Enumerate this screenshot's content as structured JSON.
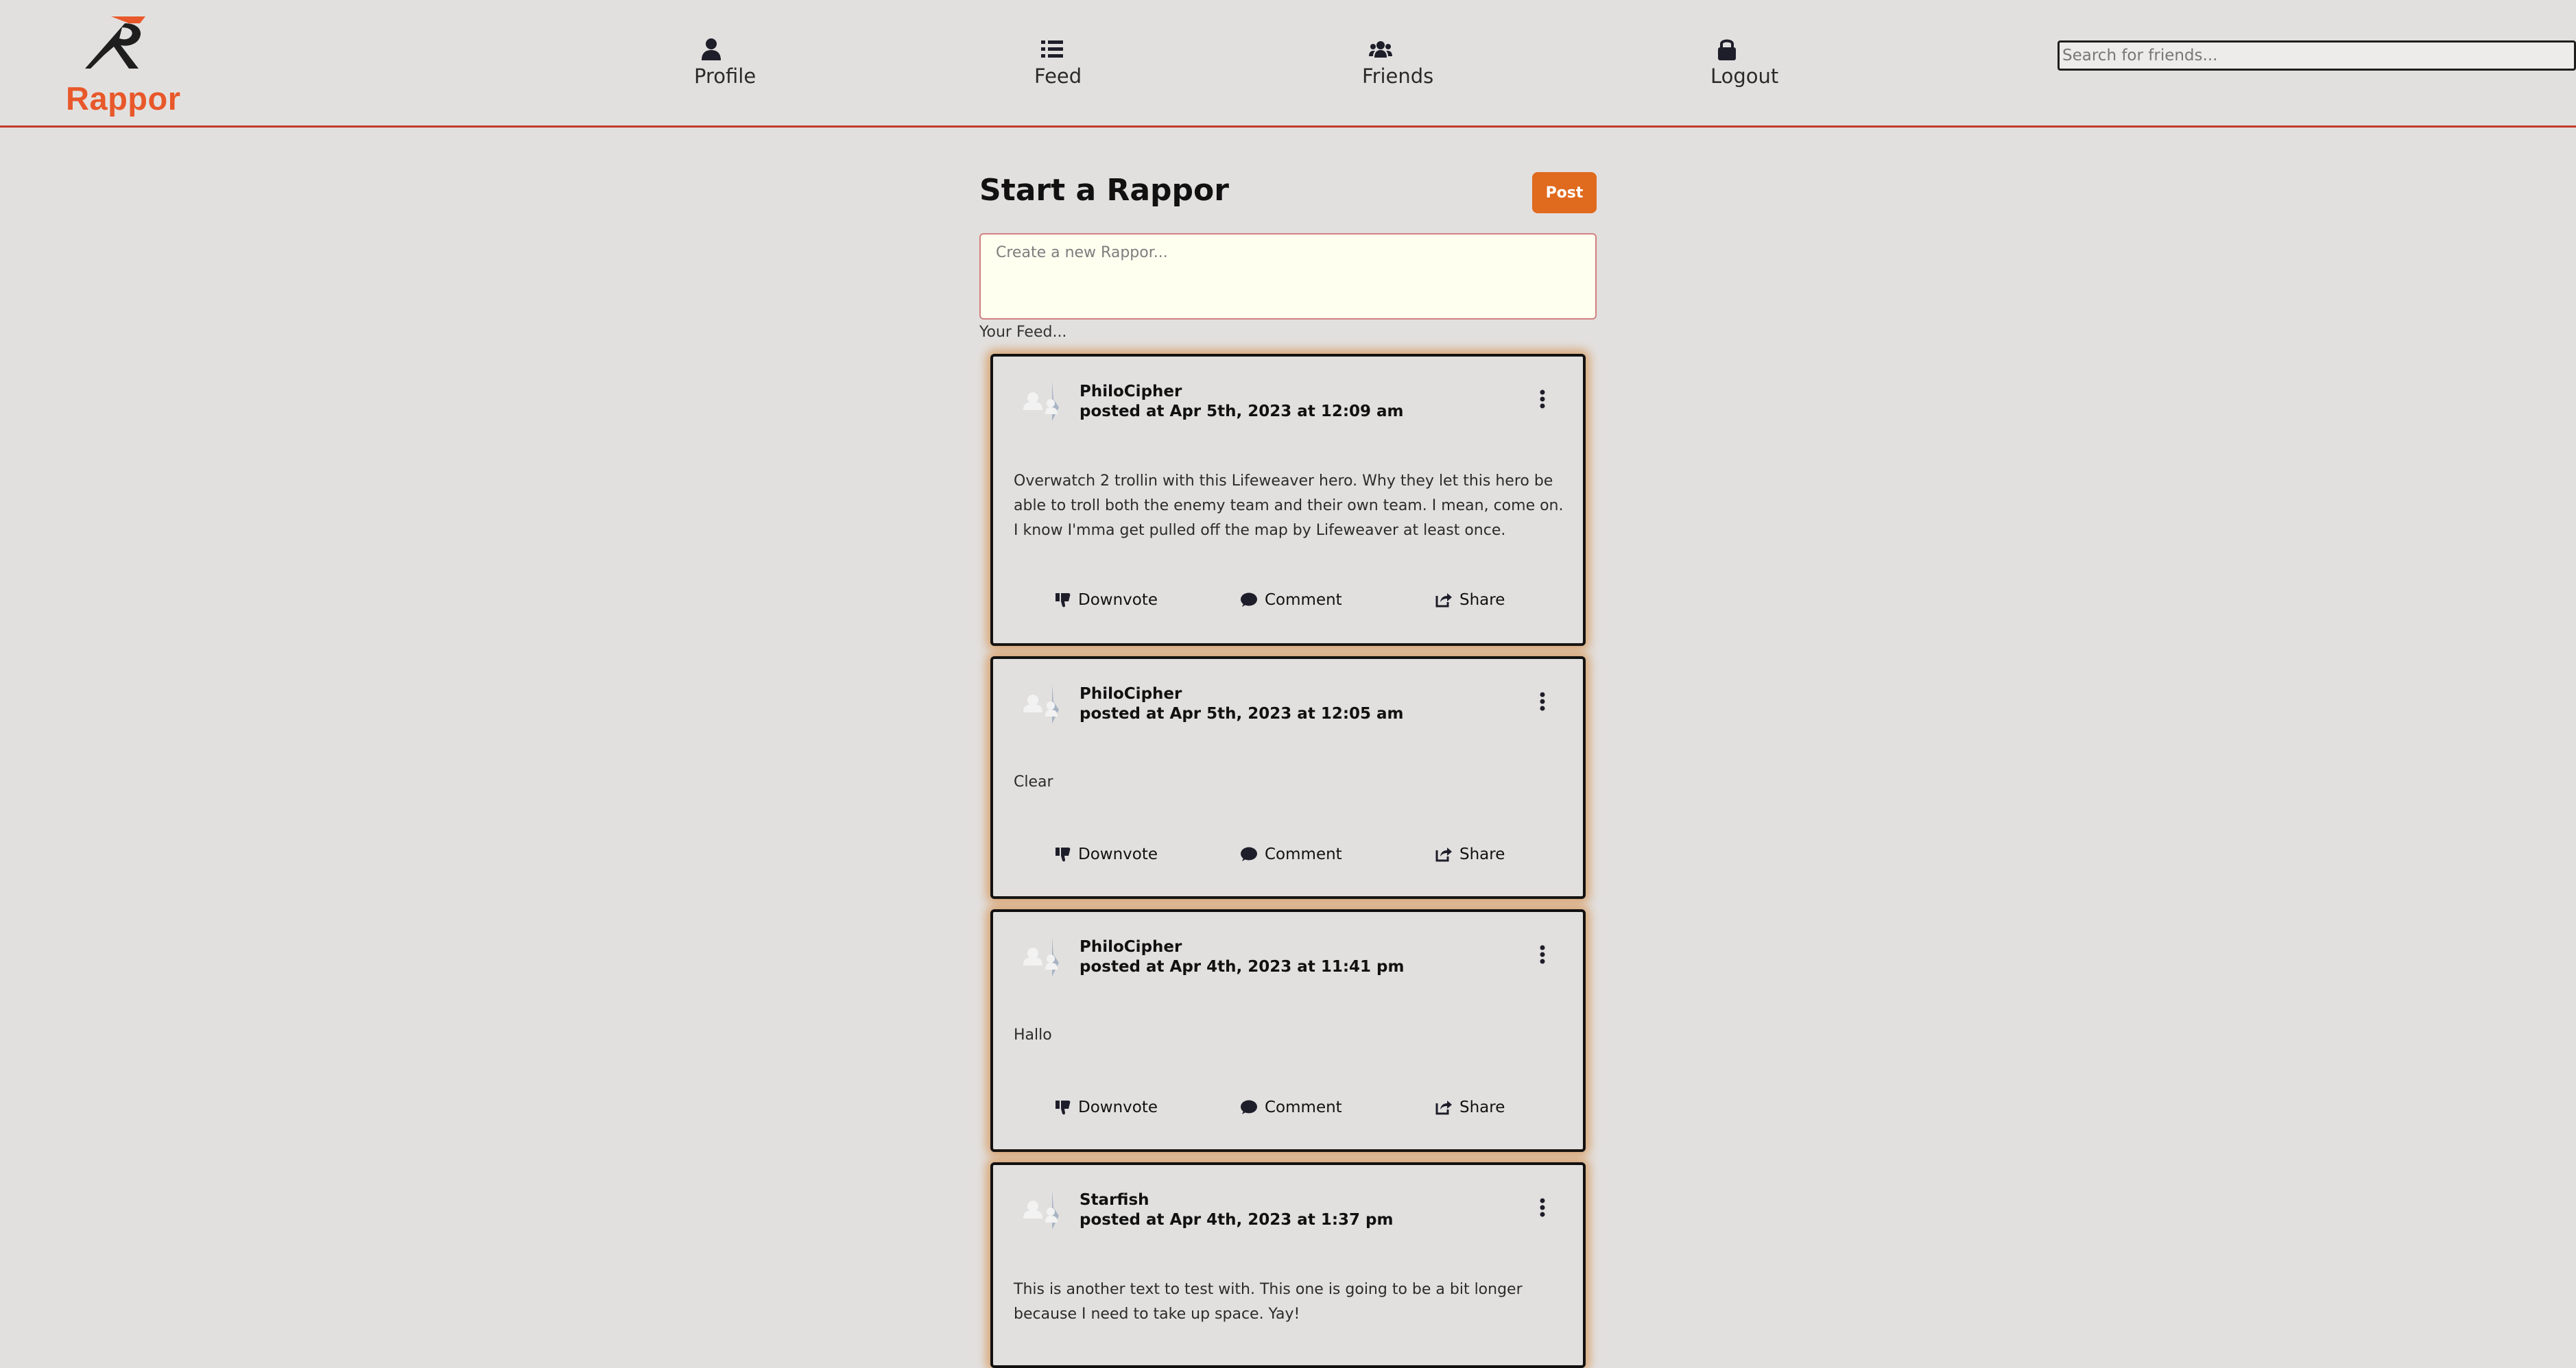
{
  "app": {
    "brand": "Rappor",
    "brand_color": "#e8582a",
    "accent_color": "#e06a1e",
    "divider_color": "#c23b2a"
  },
  "nav": {
    "items": [
      {
        "label": "Profile",
        "icon": "user-icon"
      },
      {
        "label": "Feed",
        "icon": "list-icon"
      },
      {
        "label": "Friends",
        "icon": "users-icon"
      },
      {
        "label": "Logout",
        "icon": "lock-icon"
      }
    ],
    "search_placeholder": "Search for friends..."
  },
  "composer": {
    "title": "Start a Rappor",
    "post_label": "Post",
    "placeholder": "Create a new Rappor...",
    "feed_label": "Your Feed..."
  },
  "posts": [
    {
      "author": "PhiloCipher",
      "time": "posted at Apr 5th, 2023 at 12:09 am",
      "body": "Overwatch 2 trollin with this Lifeweaver hero. Why they let this hero be able to troll both the enemy team and their own team. I mean, come on. I know I'mma get pulled off the map by Lifeweaver at least once."
    },
    {
      "author": "PhiloCipher",
      "time": "posted at Apr 5th, 2023 at 12:05 am",
      "body": "Clear"
    },
    {
      "author": "PhiloCipher",
      "time": "posted at Apr 4th, 2023 at 11:41 pm",
      "body": "Hallo"
    },
    {
      "author": "Starfish",
      "time": "posted at Apr 4th, 2023 at 1:37 pm",
      "body": "This is another text to test with. This one is going to be a bit longer because I need to take up space. Yay!"
    }
  ],
  "actions": {
    "downvote": "Downvote",
    "comment": "Comment",
    "share": "Share"
  }
}
